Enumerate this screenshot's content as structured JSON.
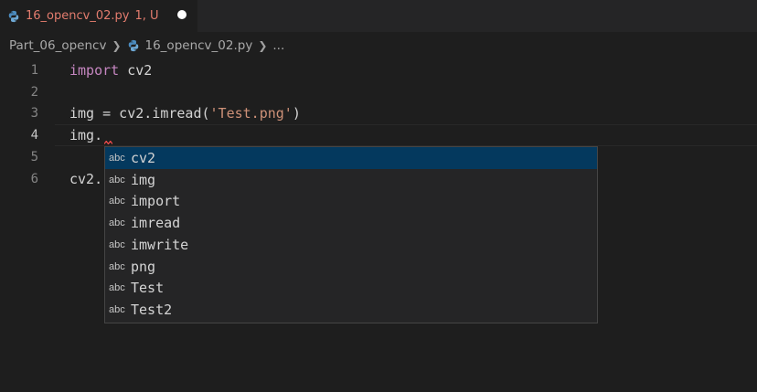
{
  "tab": {
    "filename": "16_opencv_02.py",
    "status": "1, U"
  },
  "breadcrumb": {
    "folder": "Part_06_opencv",
    "file": "16_opencv_02.py",
    "more": "..."
  },
  "gutter": {
    "lines": [
      "1",
      "2",
      "3",
      "4",
      "5",
      "6"
    ]
  },
  "code": {
    "line1": {
      "keyword": "import",
      "rest": " cv2"
    },
    "line3": {
      "pre": "img = cv2.imread(",
      "string": "'Test.png'",
      "post": ")"
    },
    "line4": {
      "text": "img."
    },
    "line6": {
      "text": "cv2."
    }
  },
  "suggest": {
    "kind_label": "abc",
    "items": [
      "cv2",
      "img",
      "import",
      "imread",
      "imwrite",
      "png",
      "Test",
      "Test2"
    ]
  },
  "colors": {
    "keyword": "#c586c0",
    "string": "#ce9178",
    "selection": "#04395e",
    "tab_text": "#e37c6e"
  }
}
